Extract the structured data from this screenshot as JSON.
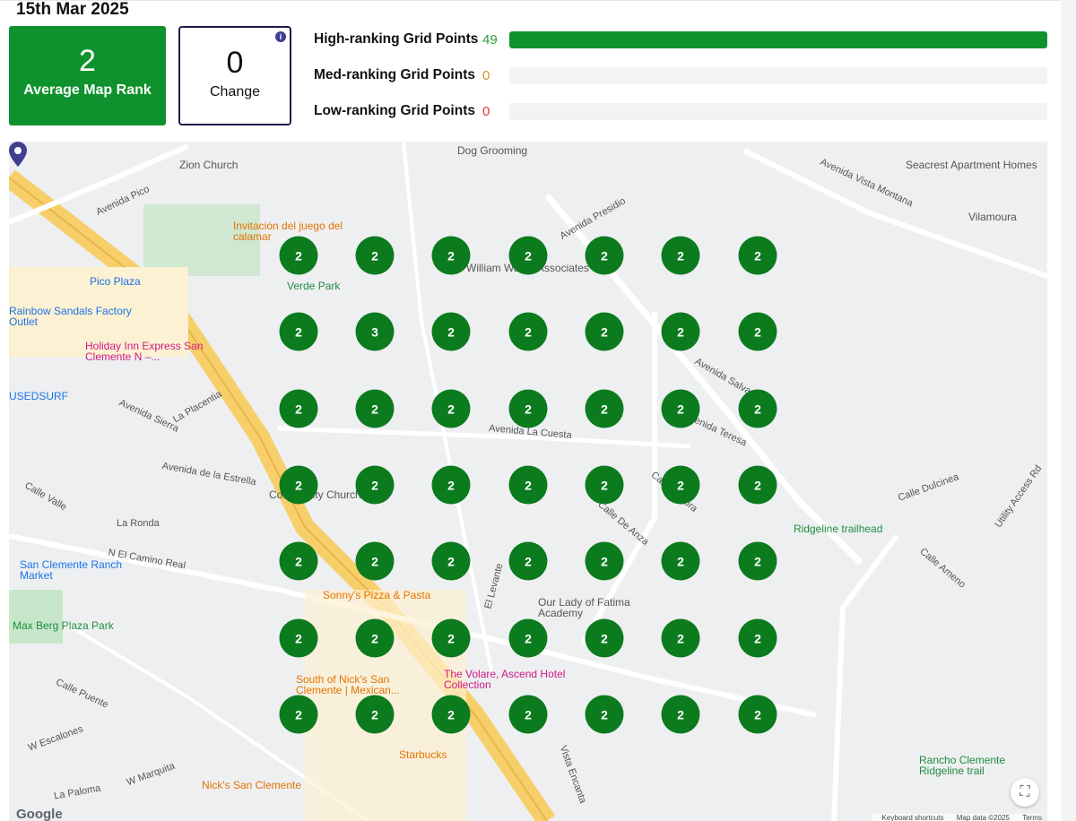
{
  "date": "15th Mar 2025",
  "avg_rank": {
    "value": "2",
    "label": "Average Map Rank"
  },
  "change": {
    "value": "0",
    "label": "Change",
    "info_icon": "i"
  },
  "stats": [
    {
      "label": "High-ranking Grid Points",
      "value": "49",
      "color": "#2e9b3c",
      "fill": 1.0
    },
    {
      "label": "Med-ranking Grid Points",
      "value": "0",
      "color": "#e0912a",
      "fill": 0
    },
    {
      "label": "Low-ranking Grid Points",
      "value": "0",
      "color": "#d33",
      "fill": 0
    }
  ],
  "grid": [
    [
      "2",
      "2",
      "2",
      "2",
      "2",
      "2",
      "2"
    ],
    [
      "2",
      "3",
      "2",
      "2",
      "2",
      "2",
      "2"
    ],
    [
      "2",
      "2",
      "2",
      "2",
      "2",
      "2",
      "2"
    ],
    [
      "2",
      "2",
      "2",
      "2",
      "2",
      "2",
      "2"
    ],
    [
      "2",
      "2",
      "2",
      "2",
      "2",
      "2",
      "2"
    ],
    [
      "2",
      "2",
      "2",
      "2",
      "2",
      "2",
      "2"
    ],
    [
      "2",
      "2",
      "2",
      "2",
      "2",
      "2",
      "2"
    ]
  ],
  "map": {
    "places": [
      {
        "t": "Zion Church",
        "c": "#555"
      },
      {
        "t": "Invitación del juego del calamar",
        "c": "#e37400"
      },
      {
        "t": "Verde Park",
        "c": "#1e8e3e"
      },
      {
        "t": "Pico Plaza",
        "c": "#1a73e8"
      },
      {
        "t": "Rainbow Sandals Factory Outlet",
        "c": "#1a73e8"
      },
      {
        "t": "Holiday Inn Express San Clemente N –...",
        "c": "#d01884"
      },
      {
        "t": "USEDSURF",
        "c": "#1a73e8"
      },
      {
        "t": "Community Church",
        "c": "#555"
      },
      {
        "t": "San Clemente Ranch Market",
        "c": "#1a73e8"
      },
      {
        "t": "Max Berg Plaza Park",
        "c": "#1e8e3e"
      },
      {
        "t": "Sonny's Pizza & Pasta",
        "c": "#e37400"
      },
      {
        "t": "Our Lady of Fatima Academy",
        "c": "#555"
      },
      {
        "t": "The Volare, Ascend Hotel Collection",
        "c": "#d01884"
      },
      {
        "t": "South of Nick's San Clemente | Mexican...",
        "c": "#e37400"
      },
      {
        "t": "Starbucks",
        "c": "#e37400"
      },
      {
        "t": "Nick's San Clemente",
        "c": "#e37400"
      },
      {
        "t": "Seacrest Apartment Homes",
        "c": "#555"
      },
      {
        "t": "Vilamoura",
        "c": "#555"
      },
      {
        "t": "Ridgeline trailhead",
        "c": "#1e8e3e"
      },
      {
        "t": "Rancho Clemente Ridgeline trail",
        "c": "#1e8e3e"
      },
      {
        "t": "Dog Grooming",
        "c": "#555"
      },
      {
        "t": "William Wall & Associates",
        "c": "#555"
      }
    ],
    "streets": [
      "Avenida Pico",
      "Avenida Vista Montana",
      "Avenida Presidio",
      "Avenida Salvador",
      "Avenida La Cuesta",
      "Avenida de la Estrella",
      "N El Camino Real",
      "Calle Valle",
      "La Ronda",
      "Calle Dulcinea",
      "Utility Access Rd",
      "Calle Ameno",
      "Avenida Sierra",
      "La Placentia",
      "W Escalones",
      "Calle Puente",
      "W Marquita",
      "La Paloma",
      "Vista Encanta",
      "Calle De Anza",
      "Calle Sonora",
      "El Levante",
      "Avenida Teresa"
    ],
    "google": "Google",
    "attribution": [
      "Keyboard shortcuts",
      "Map data ©2025",
      "Terms"
    ]
  }
}
